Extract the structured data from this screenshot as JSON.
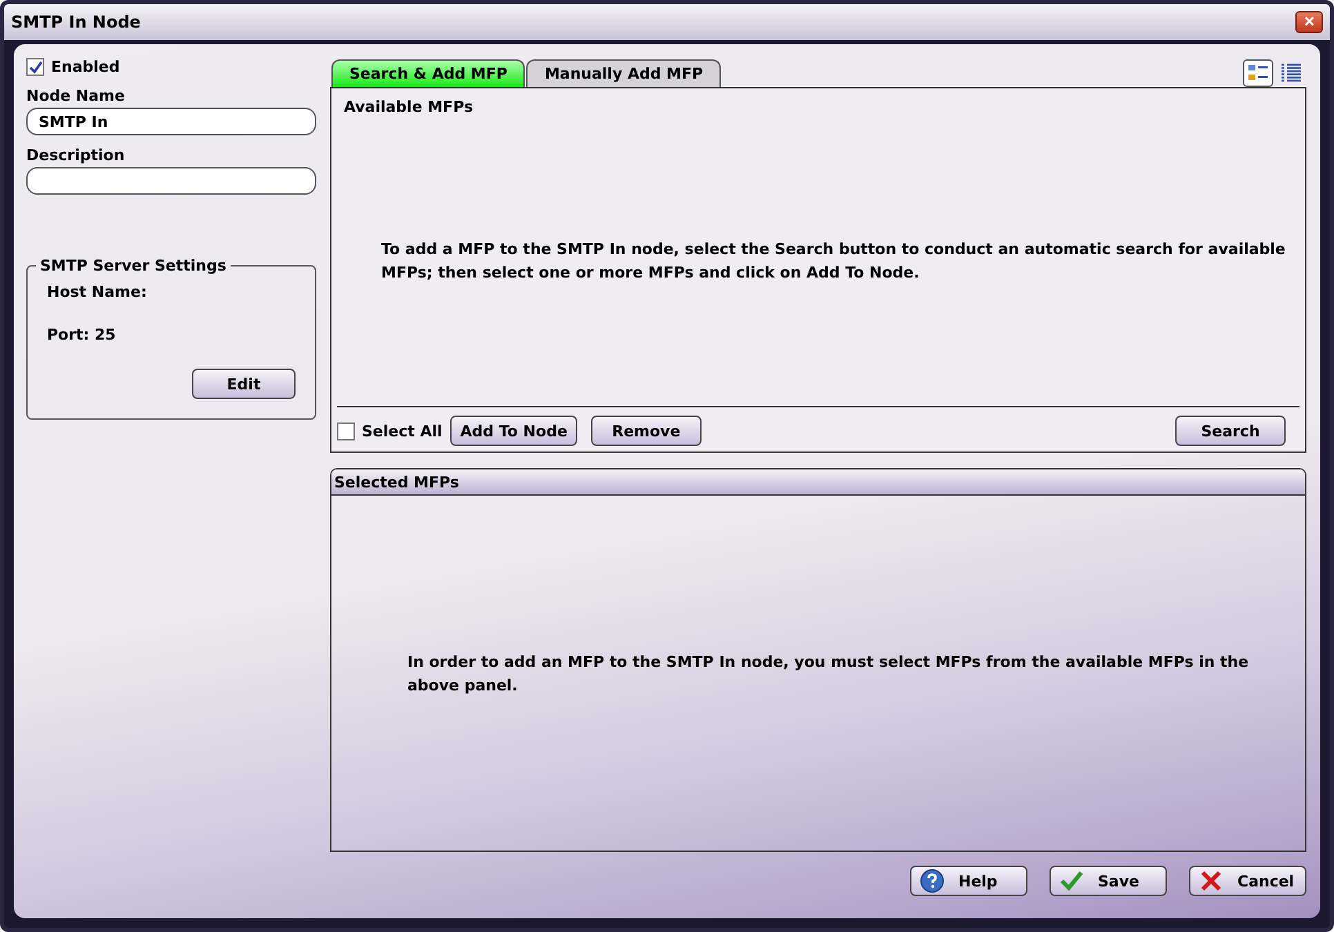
{
  "window": {
    "title": "SMTP In Node",
    "close_label": "✕"
  },
  "enabled": {
    "label": "Enabled",
    "checked": true
  },
  "node_name": {
    "label": "Node Name",
    "value": "SMTP In"
  },
  "description": {
    "label": "Description"
  },
  "server_settings": {
    "title": "SMTP Server Settings",
    "host_label": "Host Name:",
    "port_label": "Port: 25",
    "edit_button": "Edit"
  },
  "tabs": [
    {
      "label": "Search & Add MFP",
      "selected": true
    },
    {
      "label": "Manually Add MFP",
      "selected": false
    }
  ],
  "view_toggles": [
    {
      "kind": "details",
      "selected": true
    },
    {
      "kind": "list",
      "selected": false
    }
  ],
  "available": {
    "title": "Available MFPs",
    "message": "To add a MFP to the SMTP In node, select the Search button to conduct an automatic search for available MFPs; then select one or more MFPs and click on Add To Node.",
    "select_all": {
      "label": "Select All",
      "checked": false
    },
    "buttons": [
      "Add To Node",
      "Remove"
    ],
    "search_button": "Search"
  },
  "selected_panel": {
    "title": "Selected MFPs",
    "message": "In order to add an MFP to the SMTP In node, you must select MFPs from the available MFPs in the above panel."
  },
  "footer_buttons": [
    {
      "kind": "help",
      "label": "Help"
    },
    {
      "kind": "save",
      "label": "Save"
    },
    {
      "kind": "cancel",
      "label": "Cancel"
    }
  ]
}
